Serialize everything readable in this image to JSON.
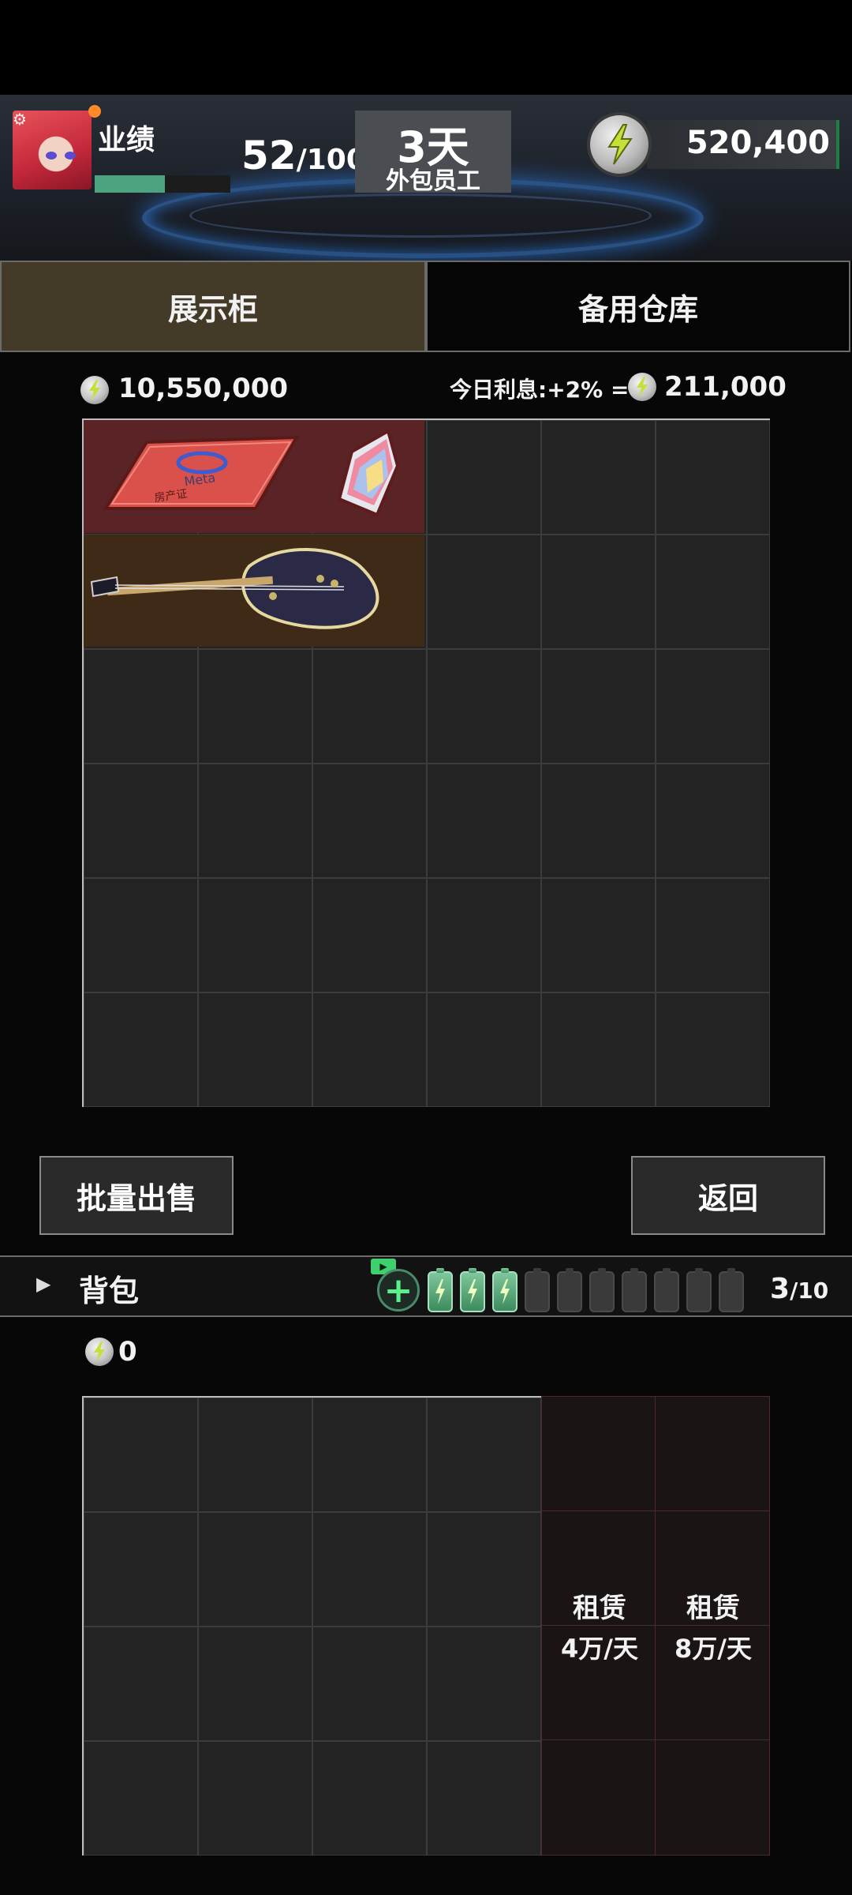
{
  "hud": {
    "performance_label": "业绩",
    "performance_value": "52",
    "performance_max": "/100",
    "performance_progress": 0.52,
    "days_big": "3天",
    "days_sub": "外包员工",
    "money": "520,400"
  },
  "tabs": [
    {
      "label": "展示柜",
      "active": true
    },
    {
      "label": "备用仓库",
      "active": false
    }
  ],
  "cabinet": {
    "total_value": "10,550,000",
    "interest_label": "今日利息:+2% =",
    "interest_value": "211,000",
    "items": [
      "Meta 房产证",
      "crystal",
      "guitar"
    ]
  },
  "buttons": {
    "sell": "批量出售",
    "back": "返回"
  },
  "bag": {
    "title": "背包",
    "count": "3",
    "max": "/10",
    "charged": 3,
    "total_value": "0",
    "rent_slots": [
      {
        "label": "租赁",
        "price": "4万/天"
      },
      {
        "label": "租赁",
        "price": "8万/天"
      }
    ]
  },
  "icons": [
    "settings-icon",
    "lightning-coin-icon",
    "play-icon",
    "add-icon",
    "battery-icon",
    "expand-arrow-icon"
  ],
  "colors": {
    "accent_green": "#4da280",
    "tab_active": "#433a27",
    "item_red": "#5a2426",
    "item_brown": "#3f2a18"
  }
}
